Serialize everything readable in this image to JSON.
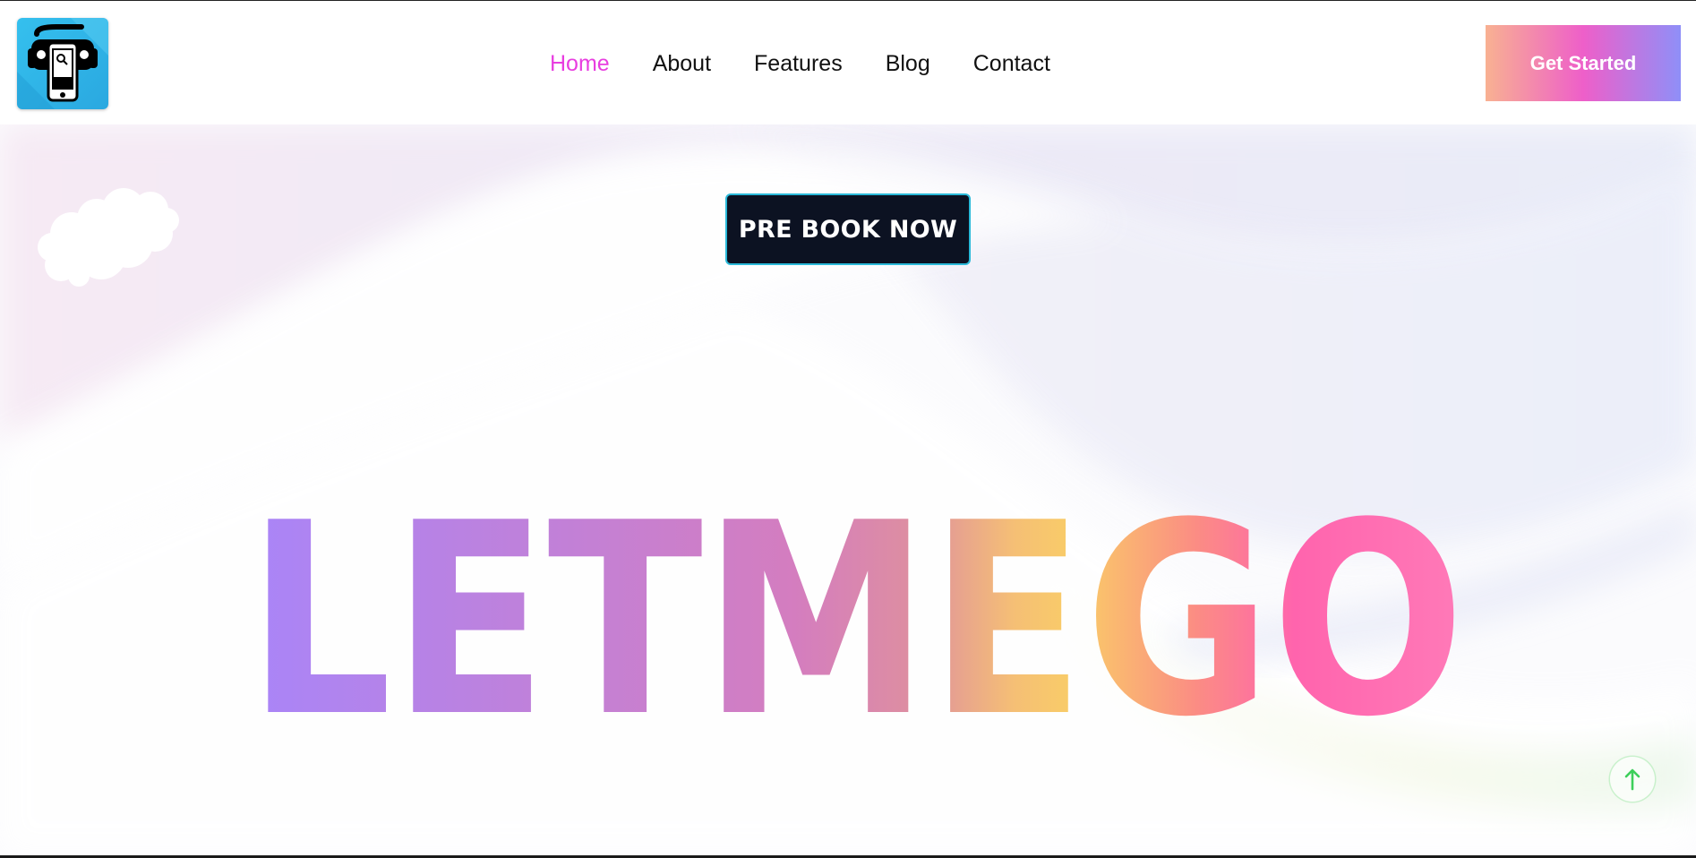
{
  "header": {
    "logo_icon": "car-phone-app-icon",
    "nav": [
      {
        "label": "Home",
        "active": true
      },
      {
        "label": "About",
        "active": false
      },
      {
        "label": "Features",
        "active": false
      },
      {
        "label": "Blog",
        "active": false
      },
      {
        "label": "Contact",
        "active": false
      }
    ],
    "cta_label": "Get Started"
  },
  "hero": {
    "prebook_label": "PRE BOOK NOW",
    "brand_text": "LETMEGO",
    "scroll_top_icon": "arrow-up-icon"
  },
  "colors": {
    "nav_active": "#e83ee0",
    "cta_gradient": [
      "#f8b192",
      "#ee5fc9",
      "#8f8ff8"
    ],
    "brand_gradient": [
      "#a985f8",
      "#d77cb8",
      "#f9cd67",
      "#ff6ab2",
      "#ff73b5"
    ],
    "prebook_bg": "#0c1222",
    "prebook_border": "#2ab9d9",
    "logo_bg": "#35c0ee"
  }
}
